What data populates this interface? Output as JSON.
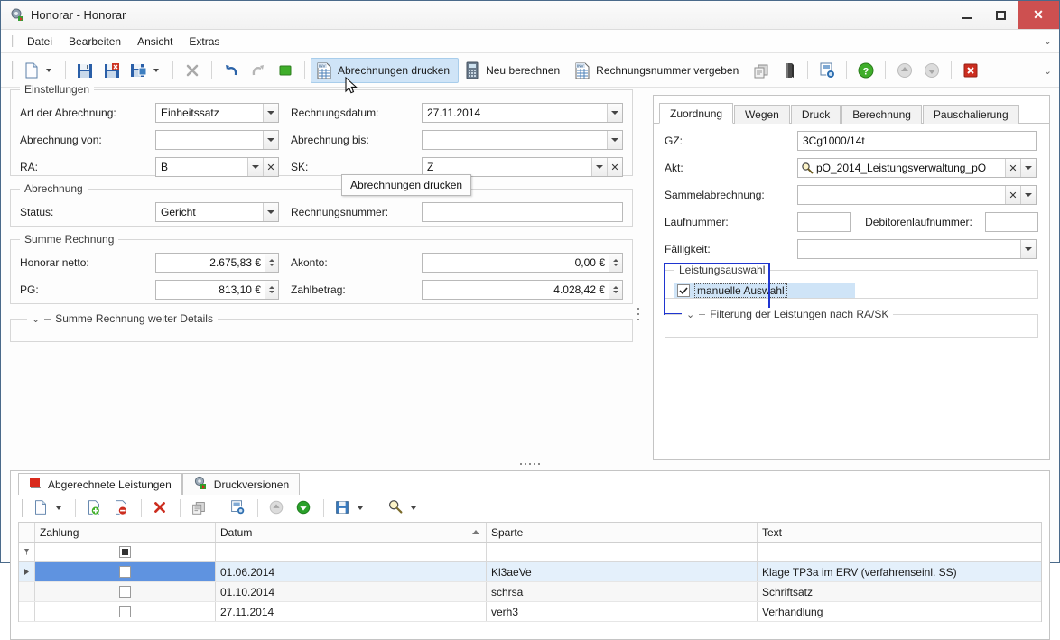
{
  "window": {
    "title": "Honorar - Honorar",
    "icon": "app-gear-icon",
    "minimize": "–",
    "maximize": "□",
    "close": "✕"
  },
  "menubar": {
    "items": [
      {
        "label": "Datei"
      },
      {
        "label": "Bearbeiten"
      },
      {
        "label": "Ansicht"
      },
      {
        "label": "Extras"
      }
    ],
    "overflow": "chevron-down-icon"
  },
  "toolbar": {
    "items": [
      {
        "name": "new-document-button",
        "icon": "new-document-icon",
        "label": "",
        "dropdown": true
      },
      {
        "name": "save-button",
        "icon": "save-icon",
        "label": ""
      },
      {
        "name": "save-delete-button",
        "icon": "save-delete-icon",
        "label": ""
      },
      {
        "name": "save-as-button",
        "icon": "save-as-icon",
        "label": "",
        "dropdown": true
      },
      {
        "name": "cancel-button",
        "icon": "close-x-icon",
        "label": ""
      },
      {
        "name": "undo-button",
        "icon": "undo-icon",
        "label": ""
      },
      {
        "name": "redo-button",
        "icon": "redo-icon",
        "label": ""
      },
      {
        "name": "stop-button",
        "icon": "green-square-icon",
        "label": ""
      },
      {
        "name": "print-invoices-button",
        "icon": "invoice-print-icon",
        "label": "Abrechnungen drucken",
        "active": true
      },
      {
        "name": "recalculate-button",
        "icon": "calculator-icon",
        "label": "Neu berechnen"
      },
      {
        "name": "assign-invoice-number-button",
        "icon": "invoice-number-icon",
        "label": "Rechnungsnummer vergeben"
      },
      {
        "name": "copy-button",
        "icon": "copy-icon",
        "label": ""
      },
      {
        "name": "book-button",
        "icon": "book-icon",
        "label": ""
      },
      {
        "name": "export-button",
        "icon": "export-icon",
        "label": ""
      },
      {
        "name": "help-button",
        "icon": "help-icon",
        "label": ""
      },
      {
        "name": "previous-button",
        "icon": "arrow-up-icon",
        "label": ""
      },
      {
        "name": "next-button",
        "icon": "arrow-down-icon",
        "label": ""
      },
      {
        "name": "close-window-button",
        "icon": "red-x-icon",
        "label": ""
      }
    ],
    "overflow": "chevron-down-icon"
  },
  "tooltip": {
    "text": "Abrechnungen drucken"
  },
  "einstellungen": {
    "title": "Einstellungen",
    "fields": [
      {
        "label": "Art der Abrechnung:",
        "value": "Einheitssatz",
        "kind": "combo"
      },
      {
        "label": "Rechnungsdatum:",
        "value": "27.11.2014",
        "kind": "combo"
      },
      {
        "label": "Abrechnung von:",
        "value": "",
        "kind": "combo"
      },
      {
        "label": "Abrechnung bis:",
        "value": "",
        "kind": "combo"
      },
      {
        "label": "RA:",
        "value": "B",
        "kind": "combo-clear"
      },
      {
        "label": "SK:",
        "value": "Z",
        "kind": "combo-clear"
      }
    ]
  },
  "abrechnung": {
    "title": "Abrechnung",
    "status_label": "Status:",
    "status_value": "Gericht",
    "rechnungsnummer_label": "Rechnungsnummer:",
    "rechnungsnummer_value": ""
  },
  "summe_rechnung": {
    "title": "Summe Rechnung",
    "honorar_netto_label": "Honorar netto:",
    "honorar_netto_value": "2.675,83 €",
    "akonto_label": "Akonto:",
    "akonto_value": "0,00 €",
    "pg_label": "PG:",
    "pg_value": "813,10 €",
    "zahlbetrag_label": "Zahlbetrag:",
    "zahlbetrag_value": "4.028,42 €"
  },
  "weitere_details": {
    "title": "Summe Rechnung weiter Details",
    "expander": "chevron-down-icon"
  },
  "right_panel": {
    "tabs": [
      {
        "label": "Zuordnung",
        "selected": true
      },
      {
        "label": "Wegen",
        "selected": false
      },
      {
        "label": "Druck",
        "selected": false
      },
      {
        "label": "Berechnung",
        "selected": false
      },
      {
        "label": "Pauschalierung",
        "selected": false
      }
    ],
    "gz_label": "GZ:",
    "gz_value": "3Cg1000/14t",
    "akt_label": "Akt:",
    "akt_value": "pO_2014_Leistungsverwaltung_pO",
    "akt_search_icon": "magnifier-icon",
    "sammelabrechnung_label": "Sammelabrechnung:",
    "sammelabrechnung_value": "",
    "laufnummer_label": "Laufnummer:",
    "laufnummer_value": "",
    "debitorenlaufnummer_label": "Debitorenlaufnummer:",
    "debitorenlaufnummer_value": "",
    "faelligkeit_label": "Fälligkeit:",
    "faelligkeit_value": "",
    "leistungsauswahl": {
      "title": "Leistungsauswahl",
      "checkbox_label": "manuelle Auswahl",
      "checked": true
    },
    "filterung": {
      "title": "Filterung der Leistungen nach RA/SK",
      "expander": "chevron-down-icon"
    }
  },
  "bottom_panel": {
    "tabs": [
      {
        "label": "Abgerechnete Leistungen",
        "icon": "red-square-icon",
        "selected": true
      },
      {
        "label": "Druckversionen",
        "icon": "gear-print-icon",
        "selected": false
      }
    ],
    "toolbar": [
      {
        "name": "new-row-button",
        "icon": "new-document-icon",
        "dropdown": true
      },
      {
        "name": "add-row-button",
        "icon": "add-document-icon"
      },
      {
        "name": "remove-row-button",
        "icon": "remove-document-icon"
      },
      {
        "name": "delete-button",
        "icon": "red-x-icon"
      },
      {
        "name": "duplicate-button",
        "icon": "copy-icon"
      },
      {
        "name": "export-grid-button",
        "icon": "export-icon"
      },
      {
        "name": "move-up-button",
        "icon": "arrow-up-icon"
      },
      {
        "name": "move-down-button",
        "icon": "arrow-down-icon"
      },
      {
        "name": "save-grid-button",
        "icon": "save-icon",
        "dropdown": true
      },
      {
        "name": "find-button",
        "icon": "magnifier-icon",
        "dropdown": true
      }
    ],
    "grid": {
      "columns": [
        {
          "key": "zahlung",
          "label": "Zahlung",
          "sorted": false
        },
        {
          "key": "datum",
          "label": "Datum",
          "sorted": true,
          "sort_dir": "asc"
        },
        {
          "key": "sparte",
          "label": "Sparte",
          "sorted": false
        },
        {
          "key": "text",
          "label": "Text",
          "sorted": false
        }
      ],
      "filter_row": {
        "indicator": "filter-icon",
        "zahlung": "indeterminate"
      },
      "rows": [
        {
          "indicator": "current-row-arrow",
          "zahlung": false,
          "datum": "01.06.2014",
          "sparte": "Kl3aeVe",
          "text": "Klage TP3a im ERV (verfahrenseinl. SS)",
          "selected": true
        },
        {
          "indicator": "",
          "zahlung": false,
          "datum": "01.10.2014",
          "sparte": "schrsa",
          "text": "Schriftsatz",
          "selected": false
        },
        {
          "indicator": "",
          "zahlung": false,
          "datum": "27.11.2014",
          "sparte": "verh3",
          "text": "Verhandlung",
          "selected": false
        }
      ]
    }
  },
  "colors": {
    "accent_blue": "#5f93e0",
    "highlight": "#cfe4f7",
    "focus_border": "#1f35d0",
    "close_red": "#cd5050",
    "row_selected_bg": "#e4f0fb"
  }
}
